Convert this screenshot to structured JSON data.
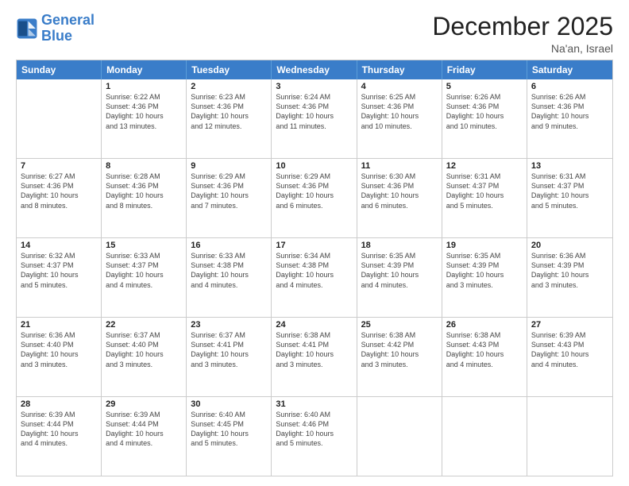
{
  "logo": {
    "text_general": "General",
    "text_blue": "Blue"
  },
  "header": {
    "month_title": "December 2025",
    "location": "Na'an, Israel"
  },
  "days_of_week": [
    "Sunday",
    "Monday",
    "Tuesday",
    "Wednesday",
    "Thursday",
    "Friday",
    "Saturday"
  ],
  "weeks": [
    [
      {
        "day": "",
        "info": ""
      },
      {
        "day": "1",
        "info": "Sunrise: 6:22 AM\nSunset: 4:36 PM\nDaylight: 10 hours\nand 13 minutes."
      },
      {
        "day": "2",
        "info": "Sunrise: 6:23 AM\nSunset: 4:36 PM\nDaylight: 10 hours\nand 12 minutes."
      },
      {
        "day": "3",
        "info": "Sunrise: 6:24 AM\nSunset: 4:36 PM\nDaylight: 10 hours\nand 11 minutes."
      },
      {
        "day": "4",
        "info": "Sunrise: 6:25 AM\nSunset: 4:36 PM\nDaylight: 10 hours\nand 10 minutes."
      },
      {
        "day": "5",
        "info": "Sunrise: 6:26 AM\nSunset: 4:36 PM\nDaylight: 10 hours\nand 10 minutes."
      },
      {
        "day": "6",
        "info": "Sunrise: 6:26 AM\nSunset: 4:36 PM\nDaylight: 10 hours\nand 9 minutes."
      }
    ],
    [
      {
        "day": "7",
        "info": "Sunrise: 6:27 AM\nSunset: 4:36 PM\nDaylight: 10 hours\nand 8 minutes."
      },
      {
        "day": "8",
        "info": "Sunrise: 6:28 AM\nSunset: 4:36 PM\nDaylight: 10 hours\nand 8 minutes."
      },
      {
        "day": "9",
        "info": "Sunrise: 6:29 AM\nSunset: 4:36 PM\nDaylight: 10 hours\nand 7 minutes."
      },
      {
        "day": "10",
        "info": "Sunrise: 6:29 AM\nSunset: 4:36 PM\nDaylight: 10 hours\nand 6 minutes."
      },
      {
        "day": "11",
        "info": "Sunrise: 6:30 AM\nSunset: 4:36 PM\nDaylight: 10 hours\nand 6 minutes."
      },
      {
        "day": "12",
        "info": "Sunrise: 6:31 AM\nSunset: 4:37 PM\nDaylight: 10 hours\nand 5 minutes."
      },
      {
        "day": "13",
        "info": "Sunrise: 6:31 AM\nSunset: 4:37 PM\nDaylight: 10 hours\nand 5 minutes."
      }
    ],
    [
      {
        "day": "14",
        "info": "Sunrise: 6:32 AM\nSunset: 4:37 PM\nDaylight: 10 hours\nand 5 minutes."
      },
      {
        "day": "15",
        "info": "Sunrise: 6:33 AM\nSunset: 4:37 PM\nDaylight: 10 hours\nand 4 minutes."
      },
      {
        "day": "16",
        "info": "Sunrise: 6:33 AM\nSunset: 4:38 PM\nDaylight: 10 hours\nand 4 minutes."
      },
      {
        "day": "17",
        "info": "Sunrise: 6:34 AM\nSunset: 4:38 PM\nDaylight: 10 hours\nand 4 minutes."
      },
      {
        "day": "18",
        "info": "Sunrise: 6:35 AM\nSunset: 4:39 PM\nDaylight: 10 hours\nand 4 minutes."
      },
      {
        "day": "19",
        "info": "Sunrise: 6:35 AM\nSunset: 4:39 PM\nDaylight: 10 hours\nand 3 minutes."
      },
      {
        "day": "20",
        "info": "Sunrise: 6:36 AM\nSunset: 4:39 PM\nDaylight: 10 hours\nand 3 minutes."
      }
    ],
    [
      {
        "day": "21",
        "info": "Sunrise: 6:36 AM\nSunset: 4:40 PM\nDaylight: 10 hours\nand 3 minutes."
      },
      {
        "day": "22",
        "info": "Sunrise: 6:37 AM\nSunset: 4:40 PM\nDaylight: 10 hours\nand 3 minutes."
      },
      {
        "day": "23",
        "info": "Sunrise: 6:37 AM\nSunset: 4:41 PM\nDaylight: 10 hours\nand 3 minutes."
      },
      {
        "day": "24",
        "info": "Sunrise: 6:38 AM\nSunset: 4:41 PM\nDaylight: 10 hours\nand 3 minutes."
      },
      {
        "day": "25",
        "info": "Sunrise: 6:38 AM\nSunset: 4:42 PM\nDaylight: 10 hours\nand 3 minutes."
      },
      {
        "day": "26",
        "info": "Sunrise: 6:38 AM\nSunset: 4:43 PM\nDaylight: 10 hours\nand 4 minutes."
      },
      {
        "day": "27",
        "info": "Sunrise: 6:39 AM\nSunset: 4:43 PM\nDaylight: 10 hours\nand 4 minutes."
      }
    ],
    [
      {
        "day": "28",
        "info": "Sunrise: 6:39 AM\nSunset: 4:44 PM\nDaylight: 10 hours\nand 4 minutes."
      },
      {
        "day": "29",
        "info": "Sunrise: 6:39 AM\nSunset: 4:44 PM\nDaylight: 10 hours\nand 4 minutes."
      },
      {
        "day": "30",
        "info": "Sunrise: 6:40 AM\nSunset: 4:45 PM\nDaylight: 10 hours\nand 5 minutes."
      },
      {
        "day": "31",
        "info": "Sunrise: 6:40 AM\nSunset: 4:46 PM\nDaylight: 10 hours\nand 5 minutes."
      },
      {
        "day": "",
        "info": ""
      },
      {
        "day": "",
        "info": ""
      },
      {
        "day": "",
        "info": ""
      }
    ]
  ]
}
